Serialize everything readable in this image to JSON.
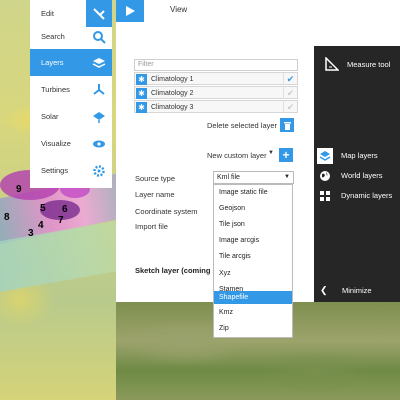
{
  "colors": {
    "accent": "#3399e6",
    "dark_panel": "#262626",
    "white": "#ffffff"
  },
  "top": {
    "view_label": "View",
    "view_icon": "play-icon"
  },
  "menu": {
    "items": [
      {
        "label": "Edit",
        "icon": "pencil-arrow-icon",
        "active": false
      },
      {
        "label": "Search",
        "icon": "search-icon",
        "active": false
      },
      {
        "label": "Layers",
        "icon": "layers-icon",
        "active": true
      },
      {
        "label": "Turbines",
        "icon": "turbine-icon",
        "active": false
      },
      {
        "label": "Solar",
        "icon": "solar-panel-icon",
        "active": false
      },
      {
        "label": "Visualize",
        "icon": "eye-icon",
        "active": false
      },
      {
        "label": "Settings",
        "icon": "gear-icon",
        "active": false
      }
    ]
  },
  "layers": {
    "filter_placeholder": "Filter",
    "rows": [
      {
        "name": "Climatology 1",
        "checked": true
      },
      {
        "name": "Climatology 2",
        "checked": false
      },
      {
        "name": "Climatology 3",
        "checked": false
      }
    ],
    "delete_label": "Delete selected layer",
    "new_custom_layer": "New custom layer"
  },
  "form": {
    "source_type_label": "Source type",
    "layer_name_label": "Layer name",
    "coord_system_label": "Coordinate system",
    "import_file_label": "Import file",
    "source_type_value": "Kml file",
    "sketch_label": "Sketch layer (coming so"
  },
  "dropdown": {
    "options": [
      "Image static file",
      "Geojson",
      "Tile json",
      "Image arcgis",
      "Tile arcgis",
      "Xyz",
      "Stamen",
      "Shapefile",
      "Kmz",
      "Zip"
    ],
    "highlighted": "Shapefile"
  },
  "side": {
    "measure_tool": "Measure tool",
    "items": [
      {
        "label": "Map layers",
        "icon": "layers-icon",
        "active": true
      },
      {
        "label": "World layers",
        "icon": "globe-icon",
        "active": false
      },
      {
        "label": "Dynamic layers",
        "icon": "grid-icon",
        "active": false
      }
    ],
    "minimize": "Minimize"
  },
  "map_markers": [
    "8",
    "4",
    "5",
    "6",
    "3",
    "7",
    "9"
  ]
}
